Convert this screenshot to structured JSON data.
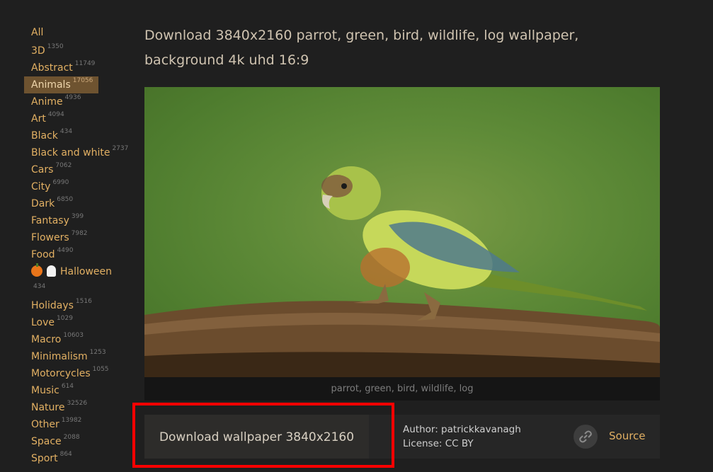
{
  "sidebar": {
    "all": "All",
    "categories": [
      {
        "label": "3D",
        "count": "1350"
      },
      {
        "label": "Abstract",
        "count": "11749"
      },
      {
        "label": "Animals",
        "count": "17056"
      },
      {
        "label": "Anime",
        "count": "4936"
      },
      {
        "label": "Art",
        "count": "4094"
      },
      {
        "label": "Black",
        "count": "434"
      },
      {
        "label": "Black and white",
        "count": "2737"
      },
      {
        "label": "Cars",
        "count": "7062"
      },
      {
        "label": "City",
        "count": "6990"
      },
      {
        "label": "Dark",
        "count": "6850"
      },
      {
        "label": "Fantasy",
        "count": "399"
      },
      {
        "label": "Flowers",
        "count": "7982"
      },
      {
        "label": "Food",
        "count": "4490"
      }
    ],
    "halloween": {
      "label": "Halloween",
      "count": "434"
    },
    "categories2": [
      {
        "label": "Holidays",
        "count": "1516"
      },
      {
        "label": "Love",
        "count": "1029"
      },
      {
        "label": "Macro",
        "count": "10603"
      },
      {
        "label": "Minimalism",
        "count": "1253"
      },
      {
        "label": "Motorcycles",
        "count": "1055"
      },
      {
        "label": "Music",
        "count": "614"
      },
      {
        "label": "Nature",
        "count": "32526"
      },
      {
        "label": "Other",
        "count": "13982"
      },
      {
        "label": "Space",
        "count": "2088"
      },
      {
        "label": "Sport",
        "count": "864"
      }
    ]
  },
  "main": {
    "title": "Download 3840x2160 parrot, green, bird, wildlife, log wallpaper, background 4k uhd 16:9",
    "tags": "parrot, green, bird, wildlife, log",
    "download_label": "Download wallpaper 3840x2160",
    "author": "Author: patrickkavanagh",
    "license": "License: CC BY",
    "source_label": "Source"
  },
  "colors": {
    "accent": "#e2b063",
    "active_bg": "#6e5330",
    "highlight": "#ff0000"
  },
  "icons": {
    "source": "link-icon"
  }
}
